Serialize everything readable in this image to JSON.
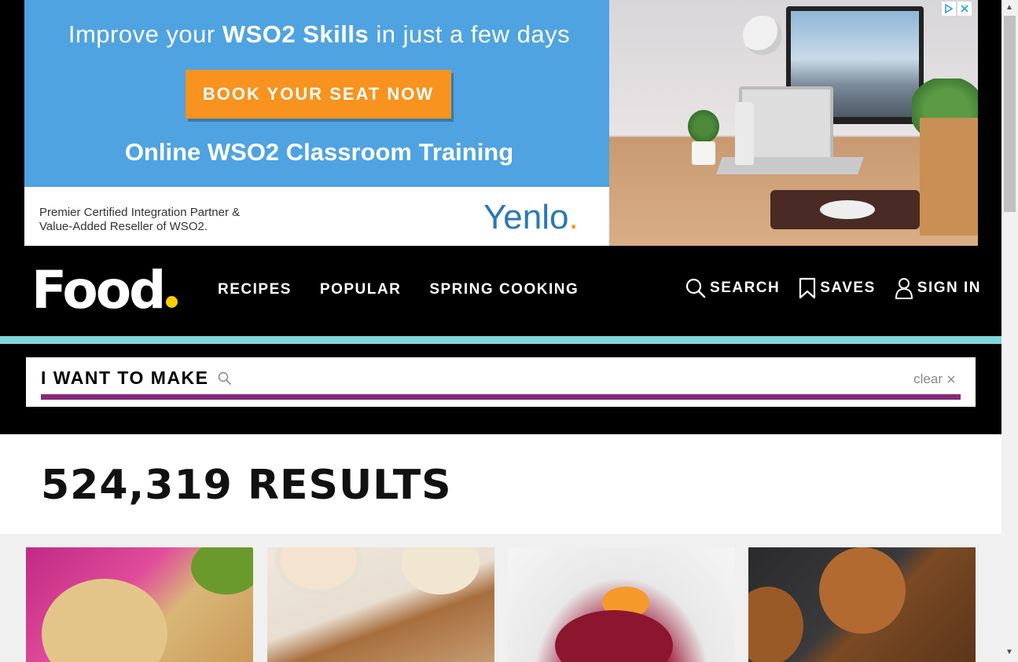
{
  "ad": {
    "headline_pre": "Improve your ",
    "headline_bold": "WSO2 Skills",
    "headline_post": " in just a few days",
    "cta": "BOOK YOUR SEAT NOW",
    "subhead": "Online WSO2 Classroom Training",
    "partner_line1": "Premier Certified Integration Partner &",
    "partner_line2": "Value-Added Reseller of WSO2.",
    "brand": "Yenlo",
    "brand_dot": ".",
    "adchoices_icon": "ad-choices-icon",
    "close_icon": "close-icon",
    "colors": {
      "panel": "#4fa3e0",
      "cta": "#f7931e",
      "brand": "#2878b8"
    }
  },
  "header": {
    "logo": "Food",
    "nav": [
      {
        "label": "RECIPES"
      },
      {
        "label": "POPULAR"
      },
      {
        "label": "SPRING COOKING"
      }
    ],
    "actions": {
      "search": "SEARCH",
      "saves": "SAVES",
      "signin": "SIGN IN"
    },
    "colors": {
      "logo_dot": "#f8d000",
      "stripe": "#7fd6d7"
    }
  },
  "search": {
    "label": "I WANT TO MAKE",
    "value": "",
    "clear": "clear",
    "colors": {
      "underline": "#862a7a"
    }
  },
  "results": {
    "count": "524,319 RESULTS"
  }
}
